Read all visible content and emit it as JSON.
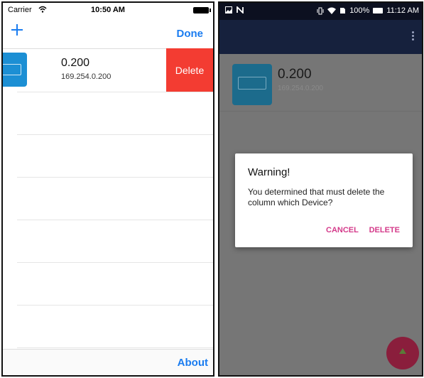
{
  "ios": {
    "status": {
      "carrier": "Carrier",
      "time": "10:50 AM"
    },
    "nav": {
      "done_label": "Done"
    },
    "device": {
      "name": "0.200",
      "ip": "169.254.0.200",
      "delete_label": "Delete"
    },
    "bottom": {
      "about_label": "About"
    }
  },
  "android": {
    "status": {
      "battery": "100%",
      "time": "11:12 AM"
    },
    "device": {
      "name": "0.200",
      "ip": "169.254.0.200"
    },
    "dialog": {
      "title": "Warning!",
      "message": "You determined that must delete the column which Device?",
      "cancel_label": "CANCEL",
      "delete_label": "DELETE"
    }
  },
  "colors": {
    "ios_accent": "#1a7cf0",
    "ios_delete": "#f33c32",
    "android_accent": "#d43a8a",
    "android_toolbar": "#16213d"
  }
}
